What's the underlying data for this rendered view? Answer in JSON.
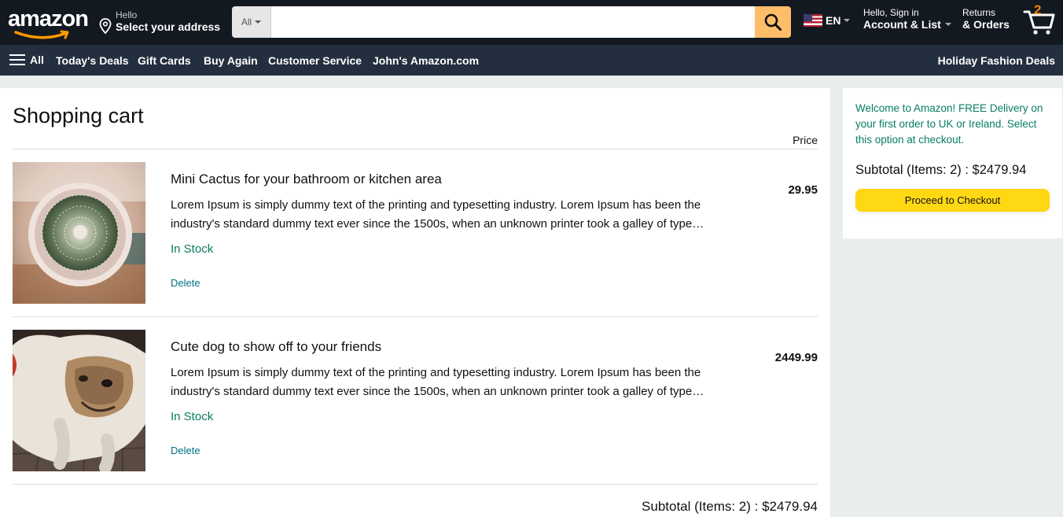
{
  "header": {
    "logo_text": "amazon",
    "address_hello": "Hello",
    "address_select": "Select your address",
    "search_category": "All",
    "search_placeholder": "",
    "language": "EN",
    "account_line1": "Hello, Sign in",
    "account_line2": "Account & List",
    "returns_line1": "Returns",
    "returns_line2": "& Orders",
    "cart_count": "2"
  },
  "nav": {
    "all": "All",
    "items": [
      "Today's Deals",
      "Gift Cards",
      "Buy Again",
      "Customer Service",
      "John's Amazon.com"
    ],
    "promo": "Holiday Fashion Deals"
  },
  "cart": {
    "title": "Shopping cart",
    "price_header": "Price",
    "items": [
      {
        "name": "Mini Cactus for your bathroom or kitchen area",
        "description": "Lorem Ipsum is simply dummy text of the printing and typesetting industry. Lorem Ipsum has been the industry's standard dummy text ever since the 1500s, when an unknown printer took a galley of type and scrambled it to make a type specimen book.",
        "stock": "In Stock",
        "delete": "Delete",
        "price": "29.95"
      },
      {
        "name": "Cute dog to show off to your friends",
        "description": "Lorem Ipsum is simply dummy text of the printing and typesetting industry. Lorem Ipsum has been the industry's standard dummy text ever since the 1500s, when an unknown printer took a galley of type and scrambled it to make a type specimen book.",
        "stock": "In Stock",
        "delete": "Delete",
        "price": "2449.99"
      }
    ],
    "subtotal": "Subtotal (Items: 2) : $2479.94"
  },
  "sidebar": {
    "welcome": "Welcome to Amazon! FREE Delivery on your first order to UK or Ireland. Select this option at checkout.",
    "subtotal": "Subtotal (Items: 2) : $2479.94",
    "checkout_label": "Proceed to Checkout"
  },
  "colors": {
    "header_bg": "#131921",
    "nav_bg": "#232f3e",
    "search_button": "#febd69",
    "checkout_button": "#ffd814",
    "link": "#007185",
    "in_stock": "#067d62"
  }
}
